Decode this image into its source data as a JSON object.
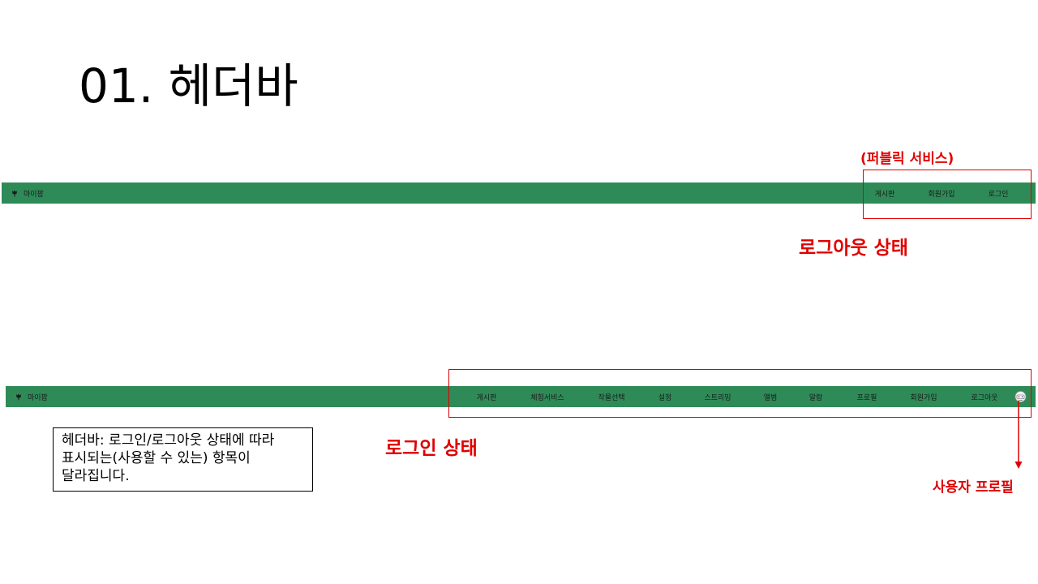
{
  "slide": {
    "title": "01. 헤더바"
  },
  "logout_header": {
    "brand": {
      "icon": "tulip-icon",
      "label": "마이팜"
    },
    "nav_items": [
      "게시판",
      "회원가입",
      "로그인"
    ]
  },
  "login_header": {
    "brand": {
      "icon": "tulip-icon",
      "label": "마이팜"
    },
    "nav_items": [
      "게시판",
      "체험서비스",
      "작물선택",
      "설정",
      "스트리밍",
      "앨범",
      "알람",
      "프로필",
      "회원가입",
      "로그아웃"
    ],
    "profile_icon": "user-avatar-icon"
  },
  "annotations": {
    "public_service": "(퍼블릭 서비스)",
    "logout_state": "로그아웃 상태",
    "login_state": "로그인 상태",
    "user_profile": "사용자 프로필",
    "description": "헤더바: 로그인/로그아웃 상태에 따라 표시되는(사용할 수 있는) 항목이 달라집니다."
  },
  "colors": {
    "navbar_bg": "#2e8b57",
    "annotation_red": "#e00000",
    "nav_text": "#1b1b1b"
  }
}
